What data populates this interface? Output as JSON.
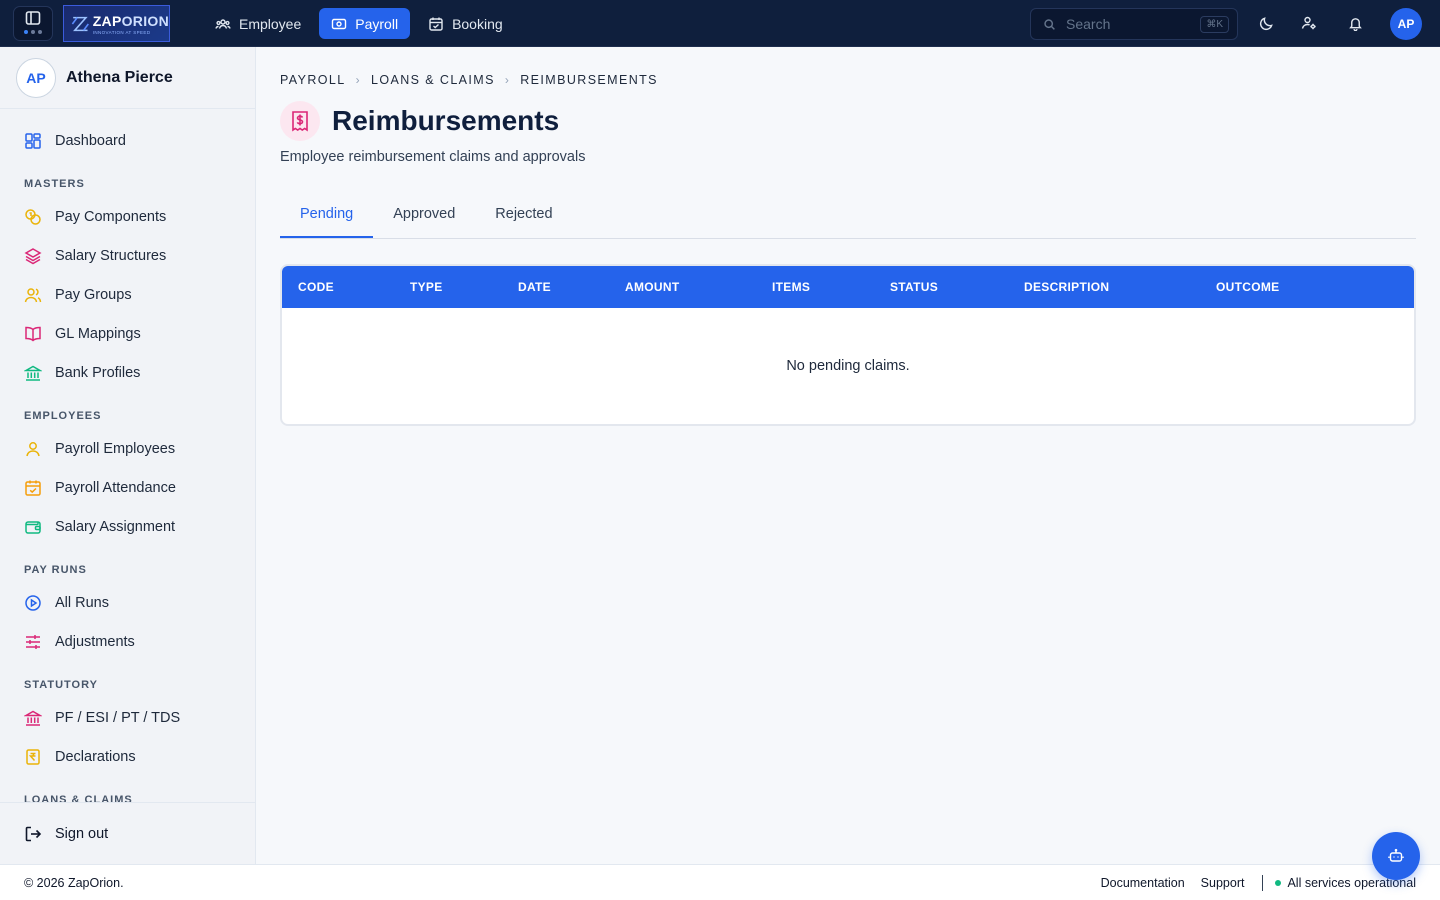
{
  "topbar": {
    "logo": {
      "name_a": "ZAP",
      "name_b": "ORION",
      "tagline": "INNOVATION AT SPEED"
    },
    "nav": [
      {
        "label": "Employee",
        "icon": "users-icon",
        "active": false
      },
      {
        "label": "Payroll",
        "icon": "payroll-icon",
        "active": true
      },
      {
        "label": "Booking",
        "icon": "calendar-check-icon",
        "active": false
      }
    ],
    "search": {
      "placeholder": "Search",
      "shortcut": "⌘K"
    },
    "avatar": "AP"
  },
  "sidebar": {
    "profile": {
      "initials": "AP",
      "name": "Athena Pierce"
    },
    "dashboard": "Dashboard",
    "sections": {
      "masters": "MASTERS",
      "employees": "EMPLOYEES",
      "pay_runs": "PAY RUNS",
      "statutory": "STATUTORY",
      "loans_claims": "LOANS & CLAIMS"
    },
    "items": {
      "pay_components": "Pay Components",
      "salary_structures": "Salary Structures",
      "pay_groups": "Pay Groups",
      "gl_mappings": "GL Mappings",
      "bank_profiles": "Bank Profiles",
      "payroll_employees": "Payroll Employees",
      "payroll_attendance": "Payroll Attendance",
      "salary_assignment": "Salary Assignment",
      "all_runs": "All Runs",
      "adjustments": "Adjustments",
      "pf_esi": "PF / ESI / PT / TDS",
      "declarations": "Declarations"
    },
    "sign_out": "Sign out"
  },
  "main": {
    "breadcrumb": [
      "PAYROLL",
      "LOANS & CLAIMS",
      "REIMBURSEMENTS"
    ],
    "title": "Reimbursements",
    "subtitle": "Employee reimbursement claims and approvals",
    "tabs": [
      "Pending",
      "Approved",
      "Rejected"
    ],
    "active_tab": "Pending",
    "table": {
      "columns": [
        "CODE",
        "TYPE",
        "DATE",
        "AMOUNT",
        "ITEMS",
        "STATUS",
        "DESCRIPTION",
        "OUTCOME"
      ],
      "empty_message": "No pending claims."
    }
  },
  "footer": {
    "copyright": "© 2026 ZapOrion.",
    "links": [
      "Documentation",
      "Support"
    ],
    "status": "All services operational"
  },
  "colors": {
    "primary": "#2563eb",
    "topbar_bg": "#0f1f3d",
    "status_ok": "#10b981",
    "title_icon_bg": "#fce7f0",
    "title_icon": "#db2777"
  }
}
